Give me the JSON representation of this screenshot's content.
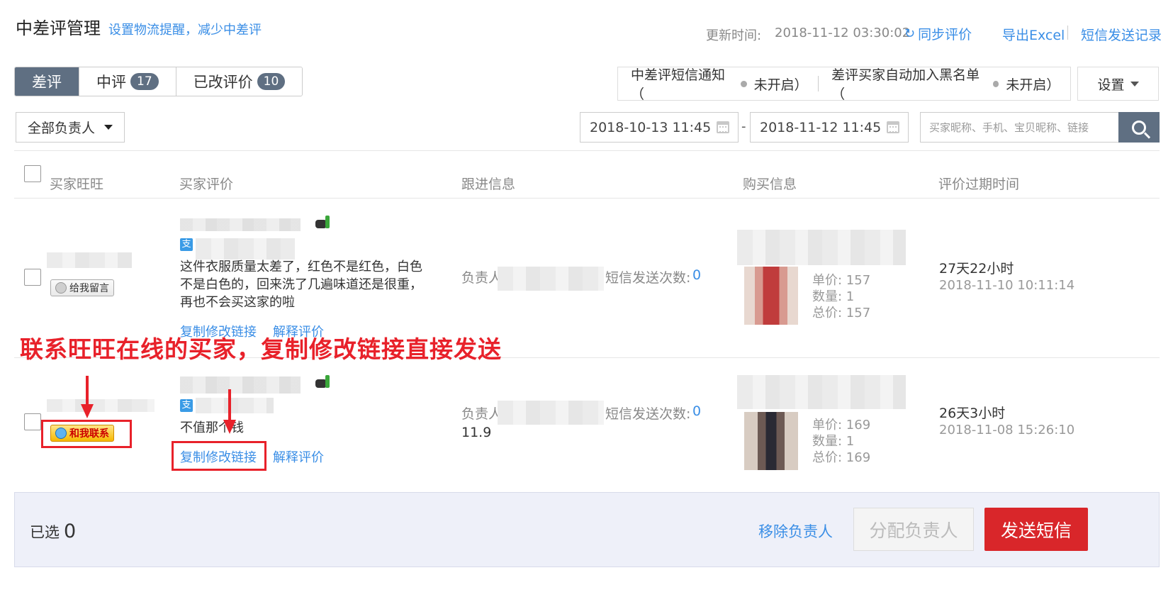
{
  "header": {
    "title": "中差评管理",
    "subtitle_link": "设置物流提醒，减少中差评",
    "update_label": "更新时间:",
    "update_time": "2018-11-12 03:30:02",
    "sync_label": "同步评价",
    "export_label": "导出Excel",
    "sms_log_label": "短信发送记录"
  },
  "tabs": [
    {
      "label": "差评",
      "count": "",
      "active": true
    },
    {
      "label": "中评",
      "count": "17",
      "active": false
    },
    {
      "label": "已改评价",
      "count": "10",
      "active": false
    }
  ],
  "notify": {
    "sms_notify_label": "中差评短信通知（",
    "sms_notify_state": "未开启）",
    "blacklist_label": "差评买家自动加入黑名单（",
    "blacklist_state": "未开启）"
  },
  "settings_label": "设置",
  "filters": {
    "owner_select": "全部负责人",
    "date_start": "2018-10-13 11:45",
    "date_end": "2018-11-12 11:45",
    "date_separator": "-",
    "search_placeholder": "买家昵称、手机、宝贝昵称、链接"
  },
  "table": {
    "columns": [
      "买家旺旺",
      "买家评价",
      "跟进信息",
      "购买信息",
      "评价过期时间"
    ],
    "rows": [
      {
        "ww_button": "给我留言",
        "ww_online": false,
        "review": "这件衣服质量太差了，红色不是红色，白色不是白色的，回来洗了几遍味道还是很重，再也不会买这家的啦",
        "copy_link": "复制修改链接",
        "explain_link": "解释评价",
        "owner_label": "负责人",
        "sms_count_label": "短信发送次数:",
        "sms_count": "0",
        "follow_extra": "",
        "unit_price": "单价: 157",
        "quantity": "数量: 1",
        "total": "总价: 157",
        "expire_remaining": "27天22小时",
        "expire_date": "2018-11-10 10:11:14"
      },
      {
        "ww_button": "和我联系",
        "ww_online": true,
        "review": "不值那个钱",
        "copy_link": "复制修改链接",
        "explain_link": "解释评价",
        "owner_label": "负责人",
        "sms_count_label": "短信发送次数:",
        "sms_count": "0",
        "follow_extra": "11.9",
        "unit_price": "单价: 169",
        "quantity": "数量: 1",
        "total": "总价: 169",
        "expire_remaining": "26天3小时",
        "expire_date": "2018-11-08 15:26:10"
      }
    ]
  },
  "annotation": "联系旺旺在线的买家，复制修改链接直接发送",
  "bottom": {
    "selected_label": "已选",
    "selected_count": "0",
    "remove_owner": "移除负责人",
    "assign_owner": "分配负责人",
    "send_sms": "发送短信"
  },
  "colors": {
    "accent": "#3a8ee6",
    "tab_active": "#5f6f82",
    "danger": "#d9262a",
    "annotation": "#e8212a"
  }
}
